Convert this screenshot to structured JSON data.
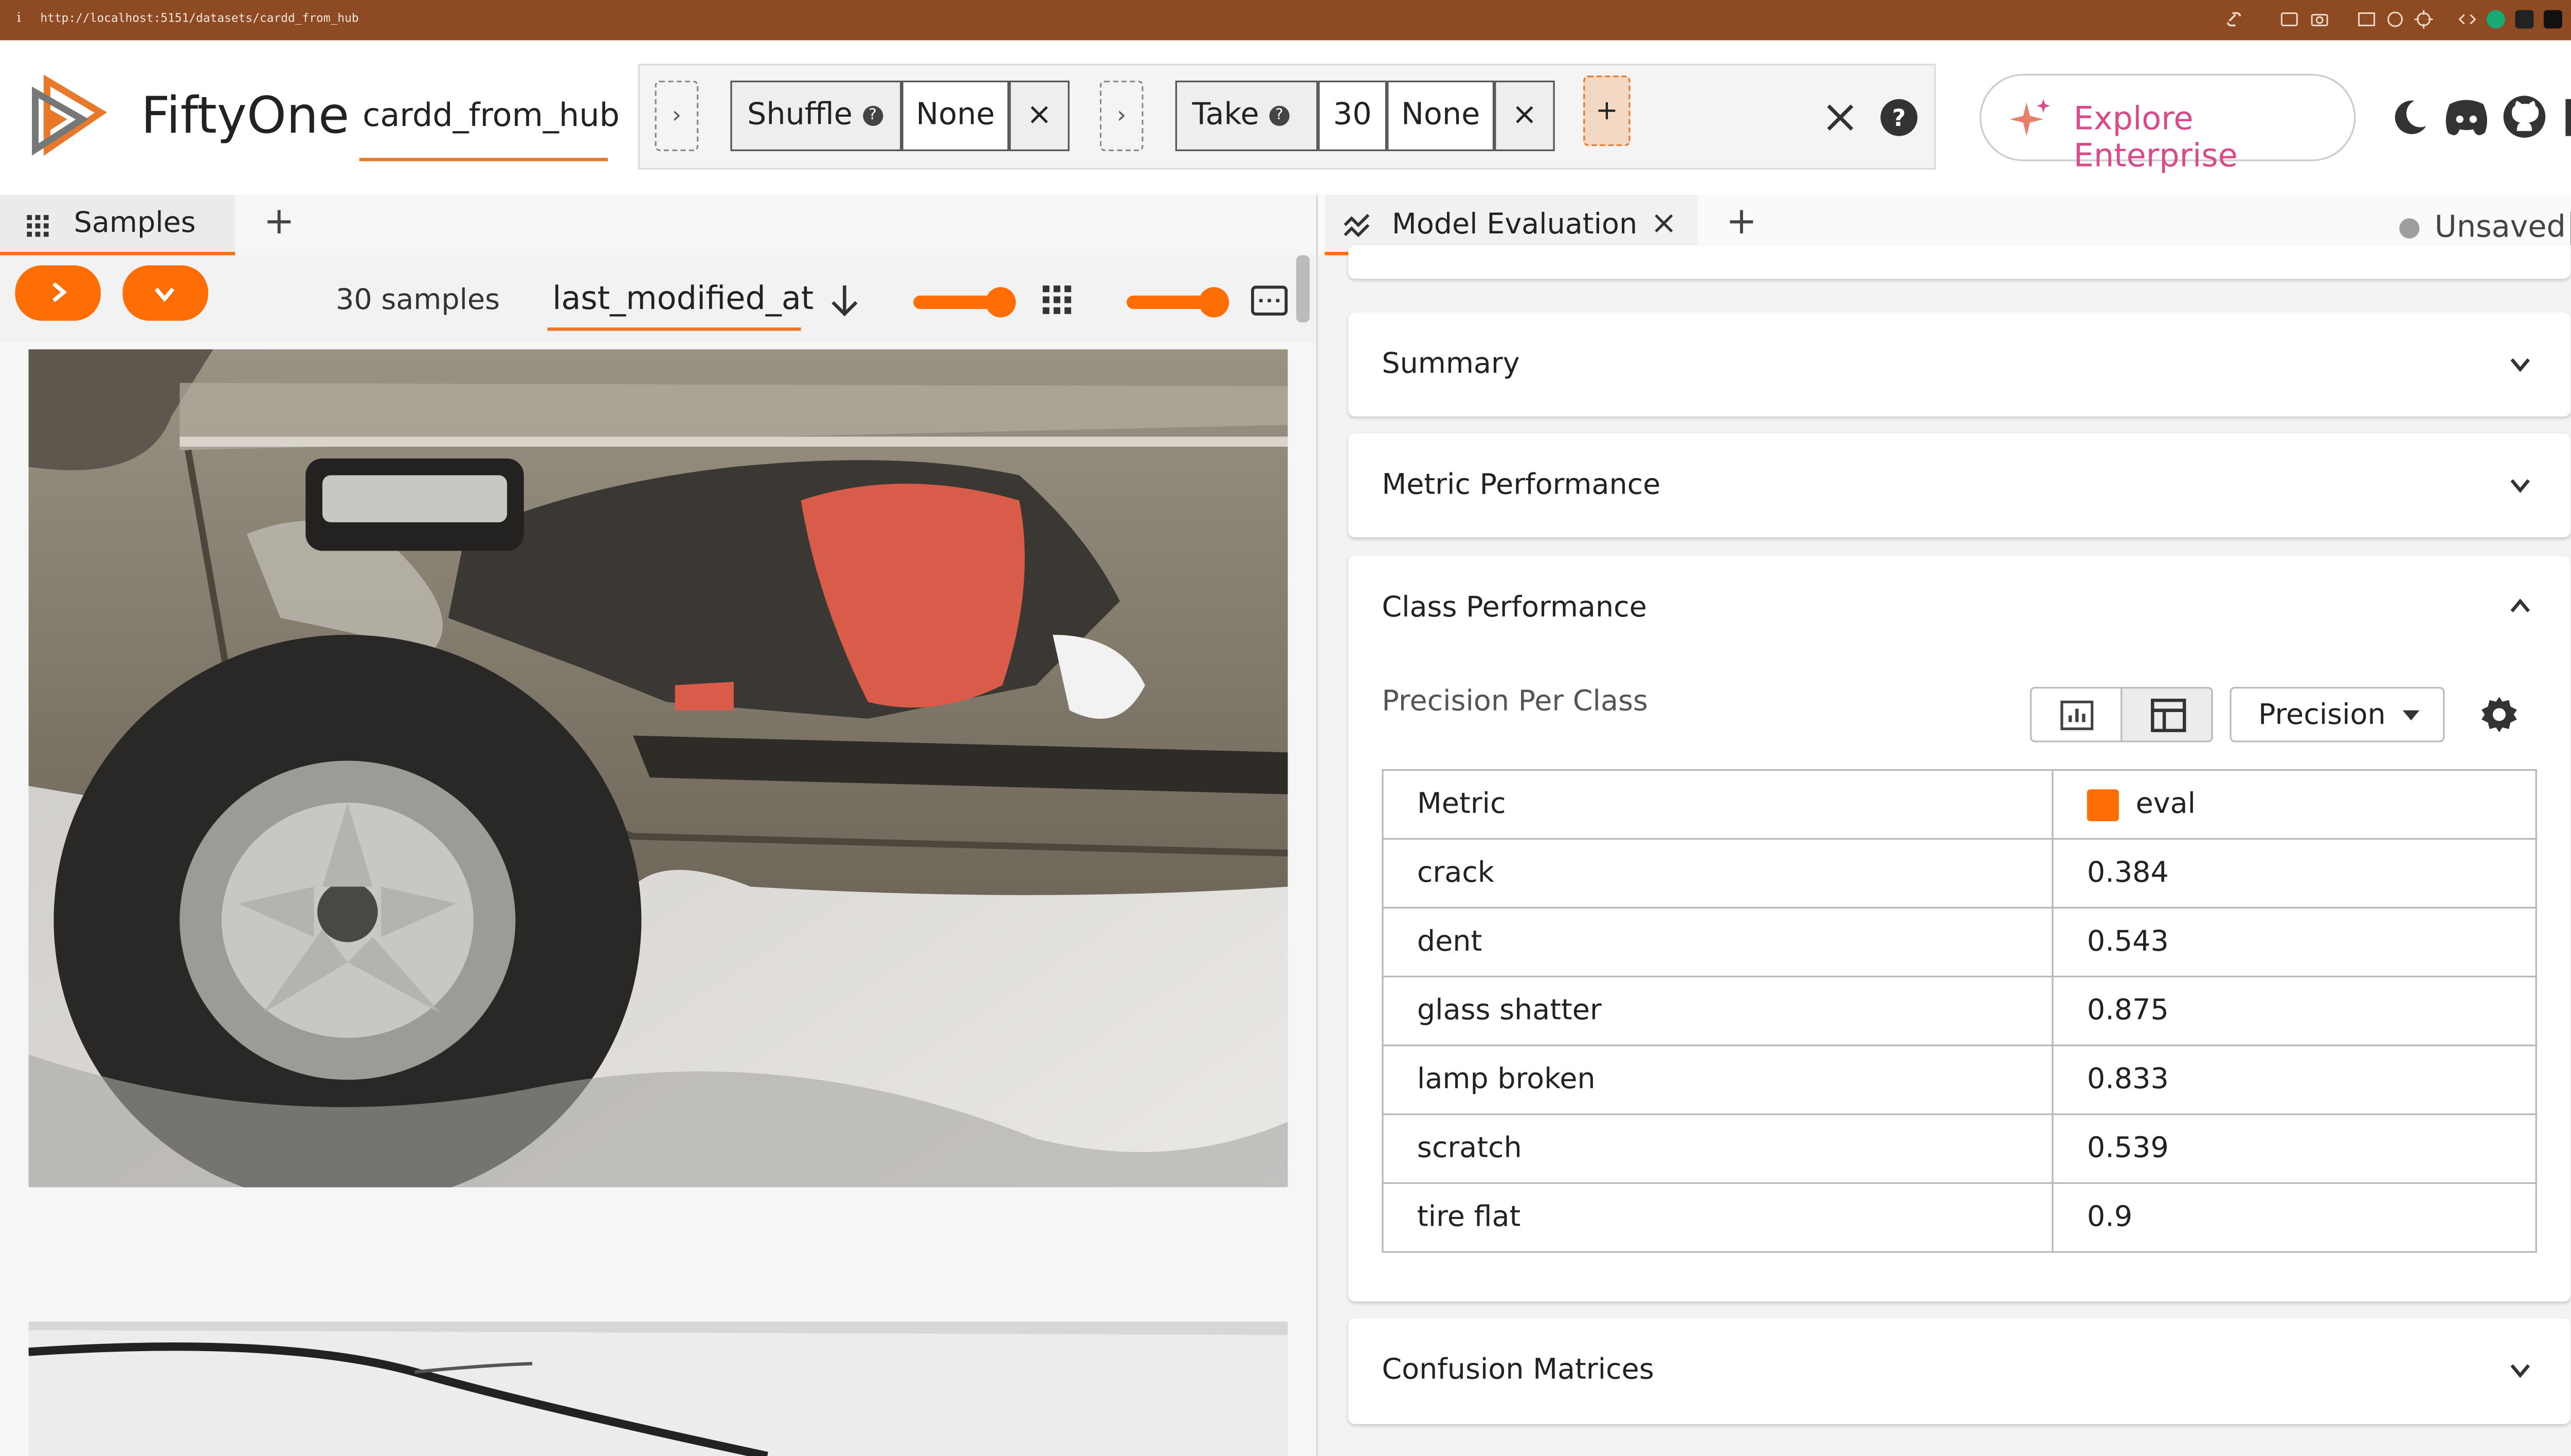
{
  "browser": {
    "url": "http://localhost:5151/datasets/cardd_from_hub",
    "info_glyph": "i"
  },
  "app": {
    "name": "FiftyOne",
    "dataset_name": "cardd_from_hub",
    "brand_color": "#ff6d04"
  },
  "view_bar": {
    "stages": [
      {
        "name": "Shuffle",
        "params": [
          "None"
        ]
      },
      {
        "name": "Take",
        "params": [
          "30",
          "None"
        ]
      }
    ],
    "add_stage": "+",
    "remove_glyph": "×",
    "next_glyph": "›"
  },
  "header": {
    "explore_label": "Explore Enterprise"
  },
  "left_panel": {
    "tab_label": "Samples",
    "add_tab": "+",
    "sample_count": "30 samples",
    "sort_field": "last_modified_at",
    "grid_zoom_level": 0.9,
    "tile_zoom_level": 0.9
  },
  "right_panel": {
    "tab_label": "Model Evaluation",
    "close_glyph": "×",
    "add_tab": "+",
    "status": "Unsaved",
    "sections": {
      "summary": "Summary",
      "metric_performance": "Metric Performance",
      "class_performance": "Class Performance",
      "confusion_matrices": "Confusion Matrices"
    },
    "class_performance": {
      "subtitle": "Precision Per Class",
      "metric_select": "Precision",
      "table": {
        "header_metric": "Metric",
        "header_series": "eval",
        "series_color": "#ff6d04",
        "rows": [
          {
            "label": "crack",
            "value": "0.384"
          },
          {
            "label": "dent",
            "value": "0.543"
          },
          {
            "label": "glass shatter",
            "value": "0.875"
          },
          {
            "label": "lamp broken",
            "value": "0.833"
          },
          {
            "label": "scratch",
            "value": "0.539"
          },
          {
            "label": "tire flat",
            "value": "0.9"
          }
        ]
      }
    }
  }
}
